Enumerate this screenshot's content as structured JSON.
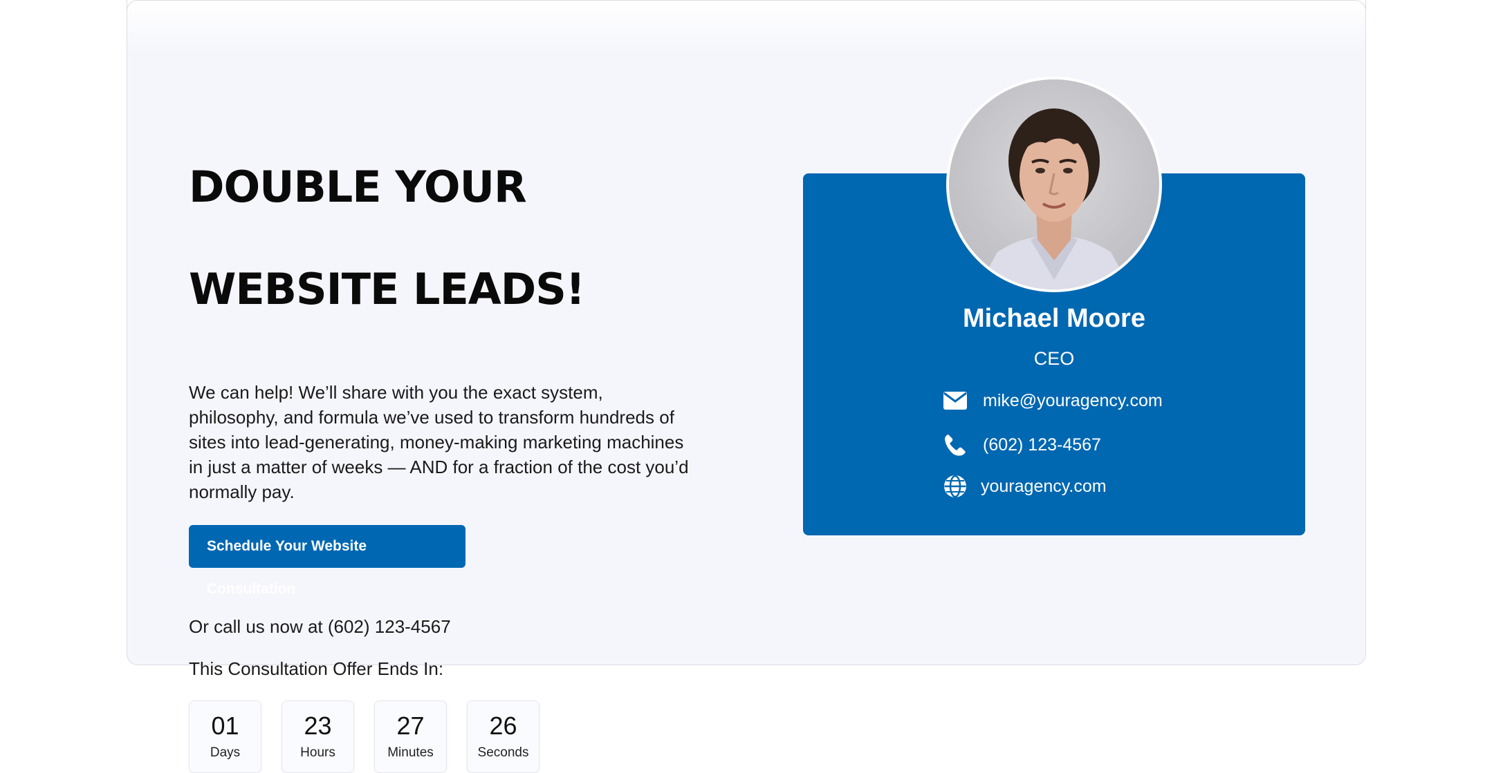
{
  "hero": {
    "headline_line1": "DOUBLE YOUR",
    "headline_line2": "WEBSITE LEADS!",
    "intro": "We can help! We’ll share with you the exact system, philosophy, and formula we’ve used to transform hundreds of sites into lead-generating, money-making marketing machines in just a matter of weeks — AND for a fraction of the cost you’d normally pay.",
    "cta_label": "Schedule Your Website Consultation",
    "call_text": "Or call us now at (602) 123-4567",
    "offer_text": "This Consultation Offer Ends In:"
  },
  "countdown": [
    {
      "value": "01",
      "label": "Days"
    },
    {
      "value": "23",
      "label": "Hours"
    },
    {
      "value": "27",
      "label": "Minutes"
    },
    {
      "value": "26",
      "label": "Seconds"
    }
  ],
  "profile": {
    "name": "Michael Moore",
    "role": "CEO",
    "email": "mike@youragency.com",
    "phone": "(602) 123-4567",
    "website": "youragency.com",
    "email_icon": "envelope-icon",
    "phone_icon": "phone-icon",
    "website_icon": "globe-icon"
  },
  "colors": {
    "accent": "#0067b1",
    "background": "#f5f6fc"
  }
}
